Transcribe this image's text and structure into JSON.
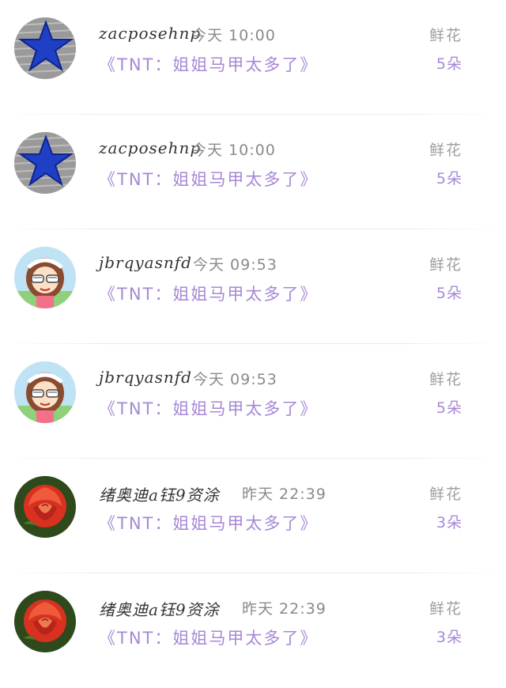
{
  "items": [
    {
      "name": "zacposehnp",
      "time": "今天 10:00",
      "message": "《TNT：姐姐马甲太多了》",
      "gift_type": "鲜花",
      "gift_count": "5朵",
      "avatar": "star-avatar"
    },
    {
      "name": "zacposehnp",
      "time": "今天 10:00",
      "message": "《TNT：姐姐马甲太多了》",
      "gift_type": "鲜花",
      "gift_count": "5朵",
      "avatar": "star-avatar"
    },
    {
      "name": "jbrqyasnfd",
      "time": "今天 09:53",
      "message": "《TNT：姐姐马甲太多了》",
      "gift_type": "鲜花",
      "gift_count": "5朵",
      "avatar": "cartoon-girl-avatar"
    },
    {
      "name": "jbrqyasnfd",
      "time": "今天 09:53",
      "message": "《TNT：姐姐马甲太多了》",
      "gift_type": "鲜花",
      "gift_count": "5朵",
      "avatar": "cartoon-girl-avatar"
    },
    {
      "name": "绪奥迪a钰9资涂",
      "time": "昨天 22:39",
      "message": "《TNT：姐姐马甲太多了》",
      "gift_type": "鲜花",
      "gift_count": "3朵",
      "avatar": "rose-avatar"
    },
    {
      "name": "绪奥迪a钰9资涂",
      "time": "昨天 22:39",
      "message": "《TNT：姐姐马甲太多了》",
      "gift_type": "鲜花",
      "gift_count": "3朵",
      "avatar": "rose-avatar"
    }
  ]
}
